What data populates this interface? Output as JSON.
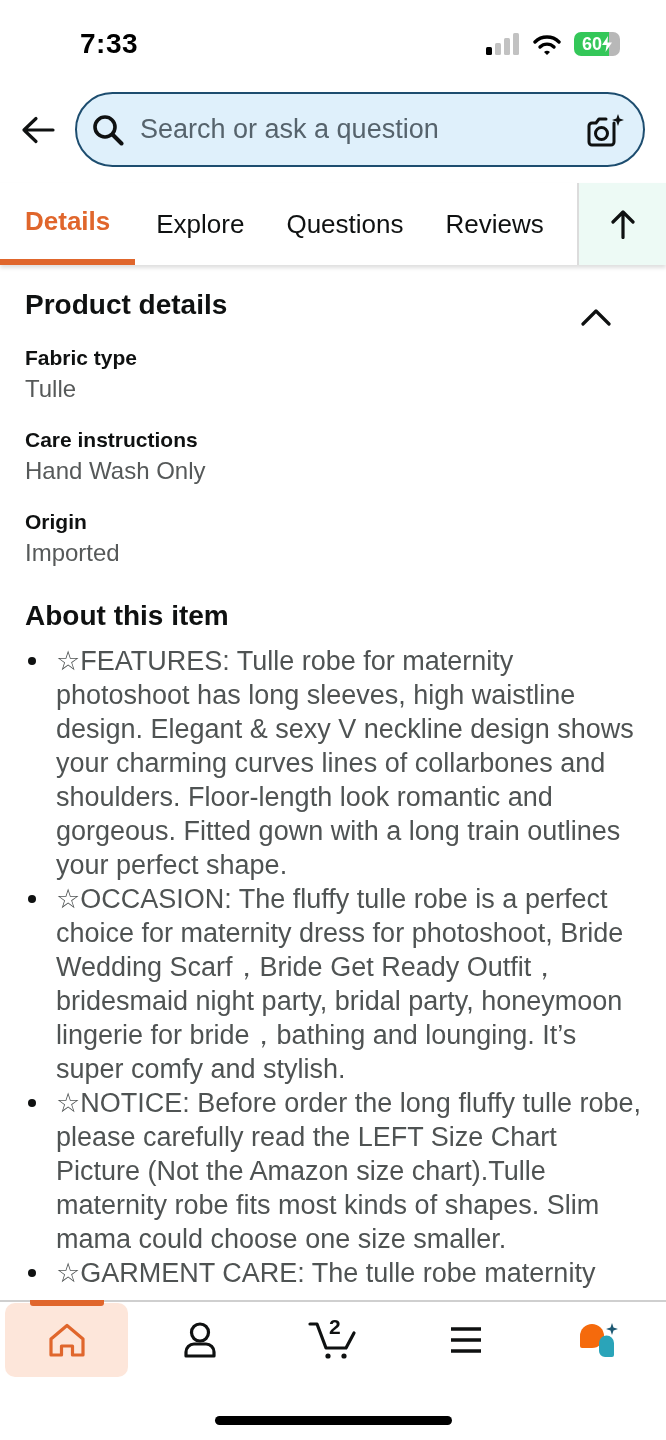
{
  "status_bar": {
    "time": "7:33",
    "battery": "60",
    "charging": true
  },
  "search": {
    "placeholder": "Search or ask a question"
  },
  "tabs": [
    {
      "label": "Details",
      "selected": true
    },
    {
      "label": "Explore",
      "selected": false
    },
    {
      "label": "Questions",
      "selected": false
    },
    {
      "label": "Reviews",
      "selected": false
    }
  ],
  "product_details": {
    "title": "Product details",
    "expanded": true,
    "rows": [
      {
        "label": "Fabric type",
        "value": "Tulle"
      },
      {
        "label": "Care instructions",
        "value": "Hand Wash Only"
      },
      {
        "label": "Origin",
        "value": "Imported"
      }
    ]
  },
  "about": {
    "title": "About this item",
    "bullets": [
      "☆FEATURES: Tulle robe for maternity photoshoot has long sleeves, high waistline design. Elegant & sexy V neckline design shows your charming curves lines of collarbones and shoulders. Floor-length look romantic and gorgeous. Fitted gown with a long train outlines your perfect shape.",
      "☆OCCASION: The fluffy tulle robe is a perfect choice for maternity dress for photoshoot, Bride Wedding Scarf，Bride Get Ready Outfit，bridesmaid night party, bridal party, honeymoon lingerie for bride，bathing and lounging. It’s super comfy and stylish.",
      "☆NOTICE: Before order the long fluffy tulle robe, please carefully read the LEFT Size Chart Picture (Not the Amazon size chart).Tulle maternity robe fits most kinds of shapes. Slim mama could choose one size smaller.",
      "☆GARMENT CARE: The tulle robe maternity"
    ]
  },
  "nav": {
    "items": [
      {
        "kind": "home",
        "selected": true
      },
      {
        "kind": "account",
        "selected": false
      },
      {
        "kind": "cart",
        "selected": false,
        "count": "2"
      },
      {
        "kind": "menu",
        "selected": false
      },
      {
        "kind": "assistant",
        "selected": false
      }
    ]
  }
}
